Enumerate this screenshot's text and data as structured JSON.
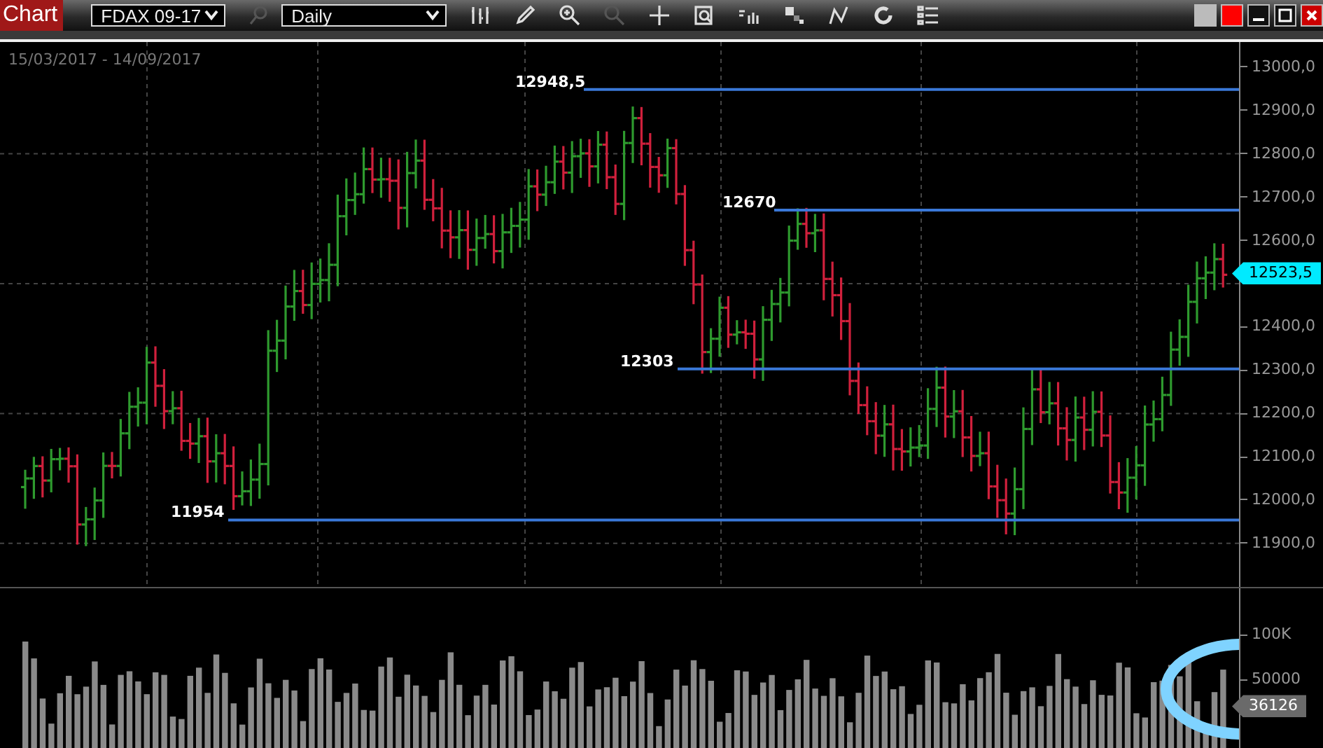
{
  "toolbar": {
    "title": "Chart",
    "symbol_select": {
      "value": "FDAX 09-17"
    },
    "interval_select": {
      "value": "Daily"
    },
    "tools": [
      {
        "kind": "search",
        "disabled": true
      },
      {
        "kind": "bars",
        "disabled": false
      },
      {
        "kind": "pencil",
        "disabled": false
      },
      {
        "kind": "zoom-in",
        "disabled": false
      },
      {
        "kind": "zoom-out",
        "disabled": true
      },
      {
        "kind": "crosshair",
        "disabled": false
      },
      {
        "kind": "report",
        "disabled": false
      },
      {
        "kind": "volume",
        "disabled": false
      },
      {
        "kind": "blocks",
        "disabled": false
      },
      {
        "kind": "line",
        "disabled": false
      },
      {
        "kind": "refresh",
        "disabled": false
      },
      {
        "kind": "list",
        "disabled": false
      }
    ],
    "window_buttons": [
      {
        "kind": "gray-square"
      },
      {
        "kind": "red-square"
      },
      {
        "kind": "minimize"
      },
      {
        "kind": "maximize"
      },
      {
        "kind": "close"
      }
    ]
  },
  "chart": {
    "date_range": "15/03/2017 - 14/09/2017",
    "price_axis": [
      "13000,0",
      "12900,0",
      "12800,0",
      "12700,0",
      "12600,0",
      "12400,0",
      "12300,0",
      "12200,0",
      "12100,0",
      "12000,0",
      "11900,0"
    ],
    "levels": [
      {
        "label": "12948,5"
      },
      {
        "label": "12670"
      },
      {
        "label": "12303"
      },
      {
        "label": "11954"
      }
    ],
    "last_price": "12523,5",
    "volume_axis": [
      "100K",
      "50000"
    ],
    "last_volume": "36126"
  }
}
